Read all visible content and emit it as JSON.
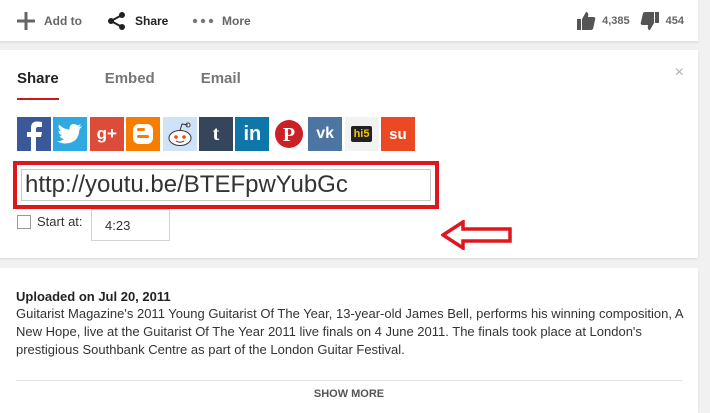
{
  "actions": {
    "add_to": "Add to",
    "share": "Share",
    "more": "More",
    "likes": "4,385",
    "dislikes": "454"
  },
  "share_panel": {
    "tabs": [
      "Share",
      "Embed",
      "Email"
    ],
    "active_tab": "Share",
    "close_glyph": "×",
    "social_icons": [
      {
        "name": "facebook-icon",
        "glyph": "f",
        "color": "#3b5998"
      },
      {
        "name": "twitter-icon",
        "glyph": "t",
        "color": "#2fa9e0"
      },
      {
        "name": "google-plus-icon",
        "glyph": "g+",
        "color": "#dd4b39"
      },
      {
        "name": "blogger-icon",
        "glyph": "B",
        "color": "#f57d00"
      },
      {
        "name": "reddit-icon",
        "glyph": "r",
        "color": "#cee3f8"
      },
      {
        "name": "tumblr-icon",
        "glyph": "t",
        "color": "#35465c"
      },
      {
        "name": "linkedin-icon",
        "glyph": "in",
        "color": "#0e76a8"
      },
      {
        "name": "pinterest-icon",
        "glyph": "P",
        "color": "#cb2027"
      },
      {
        "name": "vk-icon",
        "glyph": "vk",
        "color": "#4c75a3"
      },
      {
        "name": "hi5-icon",
        "glyph": "hi5",
        "color": "#f2f2f2"
      },
      {
        "name": "stumbleupon-icon",
        "glyph": "su",
        "color": "#eb4924"
      }
    ],
    "url": "http://youtu.be/BTEFpwYubGc",
    "start_at_label": "Start at:",
    "start_time": "4:23"
  },
  "description": {
    "uploaded": "Uploaded on Jul 20, 2011",
    "text": "Guitarist Magazine's 2011 Young Guitarist Of The Year, 13-year-old James Bell, performs his winning composition, A New Hope, live at the Guitarist Of The Year 2011 live finals on 4 June 2011. The finals took place at London's prestigious Southbank Centre as part of the London Guitar Festival.",
    "show_more": "SHOW MORE"
  },
  "annotation": {
    "highlight_color": "#e0161f"
  }
}
